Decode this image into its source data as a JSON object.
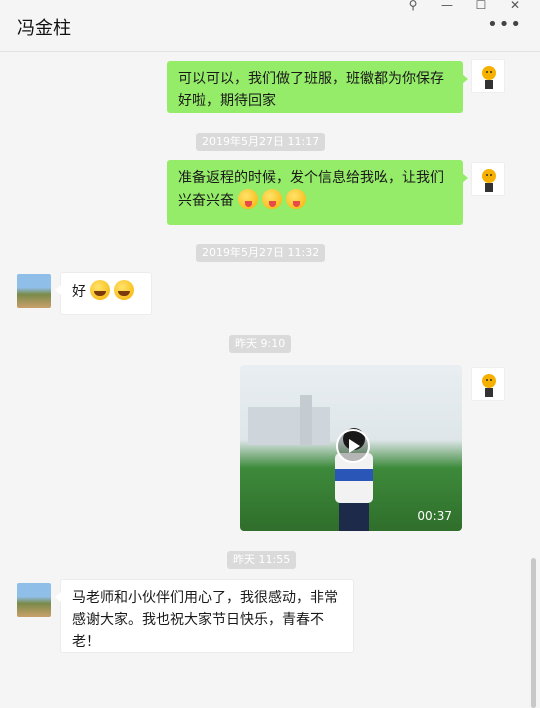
{
  "window": {
    "title": "冯金柱",
    "controls": [
      "pin-icon",
      "minimize-icon",
      "maximize-icon",
      "close-icon"
    ],
    "more_icon": "ellipsis-icon"
  },
  "messages": [
    {
      "side": "me",
      "text": "可以可以，我们做了班服，班徽都为你保存好啦，期待回家"
    },
    {
      "type": "timestamp",
      "text": "2019年5月27日 11:17"
    },
    {
      "side": "me",
      "text": "准备返程的时候，发个信息给我吆，让我们兴奋兴奋",
      "emojis": [
        "tongue-face",
        "tongue-face",
        "tongue-face"
      ]
    },
    {
      "type": "timestamp",
      "text": "2019年5月27日 11:32"
    },
    {
      "side": "other",
      "text": "好",
      "emojis": [
        "laugh-cry-face",
        "laugh-cry-face"
      ]
    },
    {
      "type": "timestamp",
      "text": "昨天 9:10"
    },
    {
      "side": "me",
      "type": "video",
      "duration": "00:37"
    },
    {
      "type": "timestamp",
      "text": "昨天 11:55"
    },
    {
      "side": "other",
      "text": "马老师和小伙伴们用心了，我很感动，非常感谢大家。我也祝大家节日快乐，青春不老！"
    }
  ],
  "colors": {
    "my_bubble": "#95ec69",
    "other_bubble": "#ffffff",
    "background": "#f5f5f5",
    "timestamp_bg": "#dadada"
  }
}
